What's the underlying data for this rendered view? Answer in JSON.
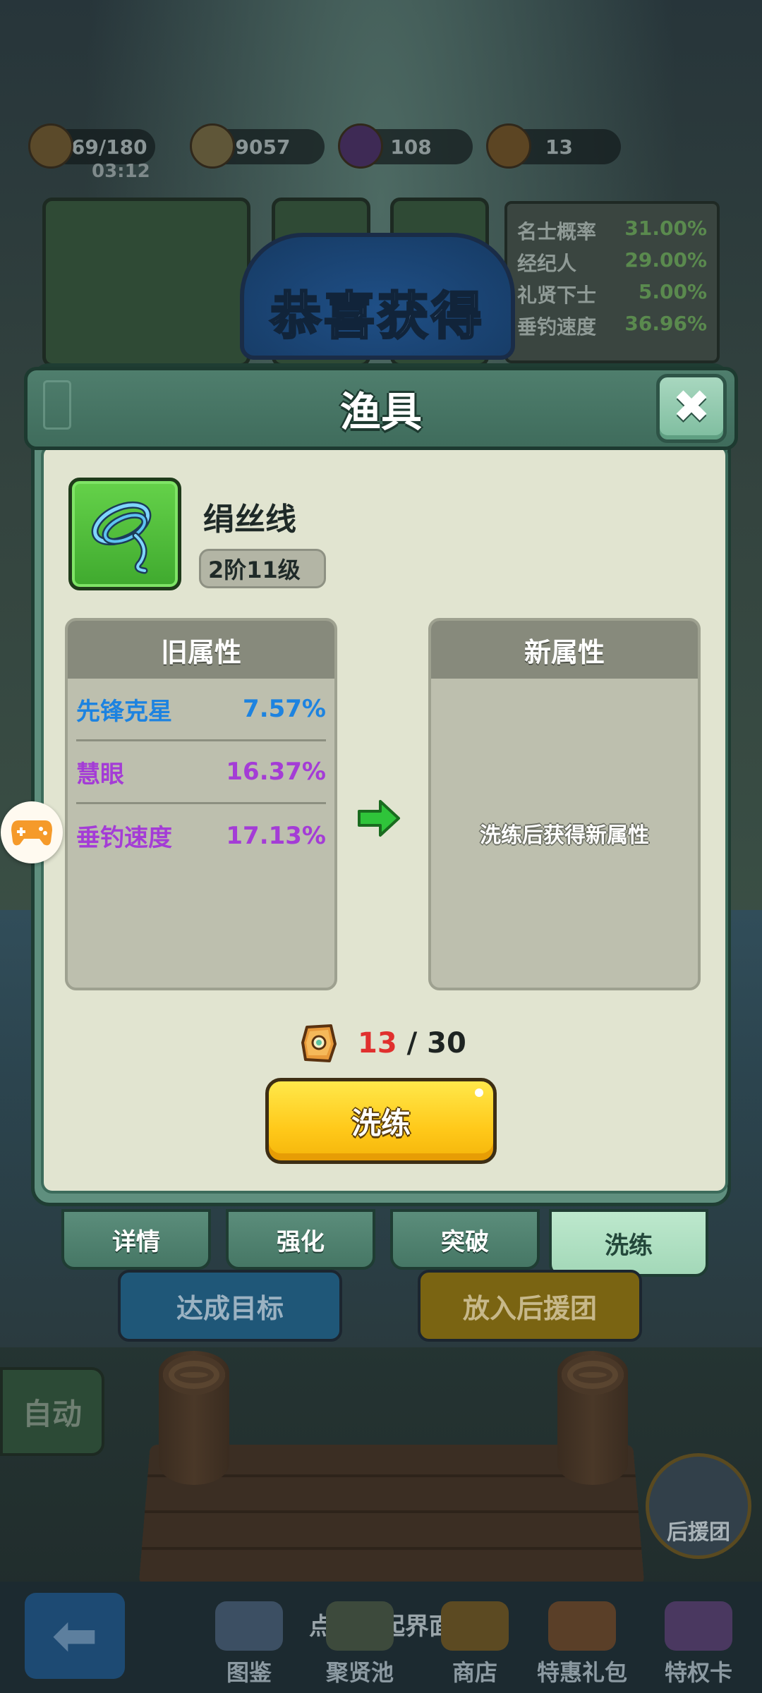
{
  "resources": {
    "stamina": "169/180",
    "timer": "03:12",
    "coins": "9057",
    "gems": "108",
    "tickets": "13"
  },
  "congrats_banner": "恭喜获得",
  "background_stats": [
    {
      "name": "名士概率",
      "value": "31.00%"
    },
    {
      "name": "经纪人",
      "value": "29.00%"
    },
    {
      "name": "礼贤下士",
      "value": "5.00%"
    },
    {
      "name": "垂钓速度",
      "value": "36.96%"
    }
  ],
  "dialog": {
    "title": "渔具",
    "item": {
      "name": "绢丝线",
      "level": "2阶11级",
      "rarity_color": "#4fc13a"
    },
    "old_panel": {
      "title": "旧属性",
      "attributes": [
        {
          "name": "先锋克星",
          "value": "7.57%",
          "color": "#1d83e0"
        },
        {
          "name": "慧眼",
          "value": "16.37%",
          "color": "#a43cd6"
        },
        {
          "name": "垂钓速度",
          "value": "17.13%",
          "color": "#a43cd6"
        }
      ]
    },
    "new_panel": {
      "title": "新属性",
      "hint": "洗练后获得新属性"
    },
    "cost": {
      "have": "13",
      "separator": " / ",
      "need": "30"
    },
    "refine_button": "洗练"
  },
  "tabs": [
    {
      "label": "详情",
      "active": false
    },
    {
      "label": "强化",
      "active": false
    },
    {
      "label": "突破",
      "active": false
    },
    {
      "label": "洗练",
      "active": true
    }
  ],
  "background_buttons": {
    "goal": "达成目标",
    "add_to_support": "放入后援团",
    "auto": "自动",
    "support_team": "后援团"
  },
  "bottom_nav": {
    "collapse_hint": "点击收起界面",
    "items": [
      "图鉴",
      "聚贤池",
      "商店",
      "特惠礼包",
      "特权卡"
    ]
  }
}
